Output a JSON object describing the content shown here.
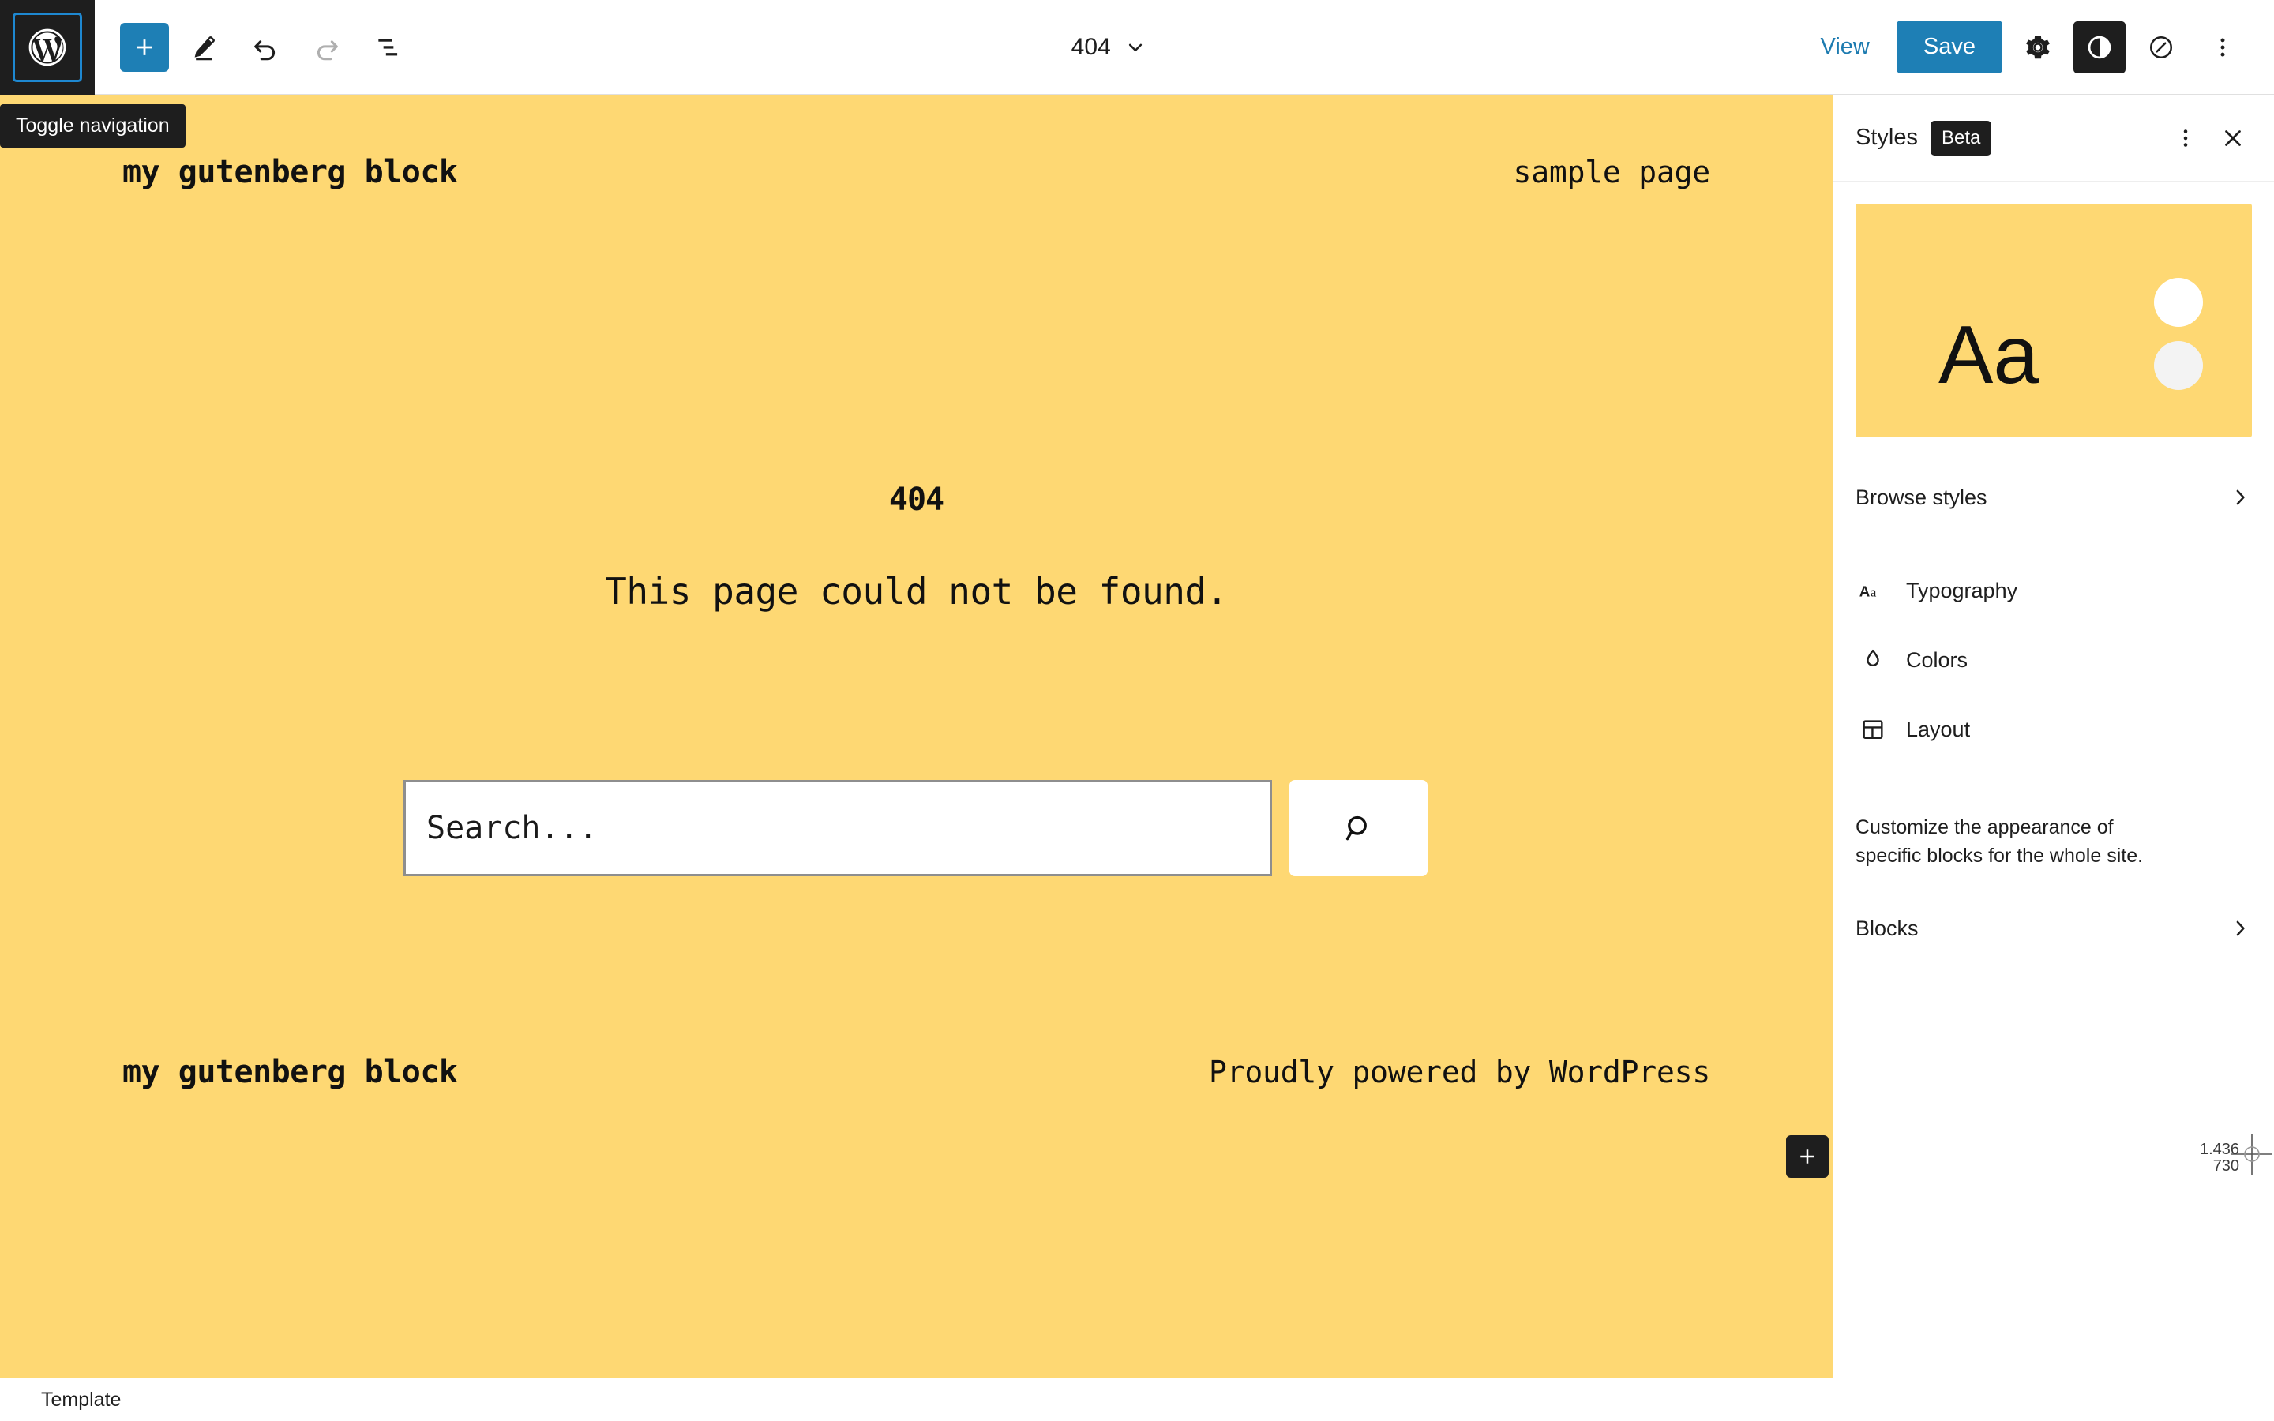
{
  "header": {
    "logo_icon": "wordpress-logo-icon",
    "tools": [
      {
        "name": "add-block-button",
        "icon": "plus-icon",
        "label": "Add block",
        "state": "primary"
      },
      {
        "name": "edit-mode-button",
        "icon": "pencil-icon",
        "label": "Edit",
        "state": "normal"
      },
      {
        "name": "undo-button",
        "icon": "undo-icon",
        "label": "Undo",
        "state": "normal"
      },
      {
        "name": "redo-button",
        "icon": "redo-icon",
        "label": "Redo",
        "state": "disabled"
      },
      {
        "name": "list-view-button",
        "icon": "list-view-icon",
        "label": "Document Overview",
        "state": "normal"
      }
    ],
    "document_title": "404",
    "document_title_chevron": "chevron-down-icon",
    "view_label": "View",
    "save_label": "Save",
    "right_icons": [
      {
        "name": "settings-button",
        "icon": "gear-icon",
        "label": "Settings",
        "active": false
      },
      {
        "name": "styles-button",
        "icon": "contrast-circle-icon",
        "label": "Styles",
        "active": true
      },
      {
        "name": "command-center-button",
        "icon": "compass-icon",
        "label": "Command",
        "active": false
      },
      {
        "name": "more-options-button",
        "icon": "kebab-menu-icon",
        "label": "Options",
        "active": false
      }
    ]
  },
  "tooltip": {
    "text": "Toggle navigation"
  },
  "canvas": {
    "background_color": "#fed873",
    "site_title": "my gutenberg block",
    "nav_link": "sample page",
    "error_code": "404",
    "error_message": "This page could not be found.",
    "search_placeholder": "Search...",
    "search_value": "",
    "search_button_icon": "magnifier-icon",
    "footer_title": "my gutenberg block",
    "footer_credit": "Proudly powered by WordPress",
    "inserter_icon": "plus-icon"
  },
  "sidebar": {
    "title": "Styles",
    "badge": "Beta",
    "more_icon": "kebab-menu-icon",
    "close_icon": "close-icon",
    "preview": {
      "sample_text": "Aa",
      "background_color": "#fed873",
      "dot_colors": [
        "#ffffff",
        "#f3f3f3"
      ]
    },
    "browse_row": {
      "label": "Browse styles",
      "chevron": "chevron-right-icon"
    },
    "menu_items": [
      {
        "label": "Typography",
        "icon": "typography-aa-icon"
      },
      {
        "label": "Colors",
        "icon": "color-droplet-icon"
      },
      {
        "label": "Layout",
        "icon": "layout-grid-icon"
      }
    ],
    "help_text": "Customize the appearance of specific blocks for the whole site.",
    "blocks_row": {
      "label": "Blocks",
      "chevron": "chevron-right-icon"
    }
  },
  "status_bar": {
    "label": "Template"
  },
  "cursor": {
    "x": "1.436",
    "y": "730"
  }
}
